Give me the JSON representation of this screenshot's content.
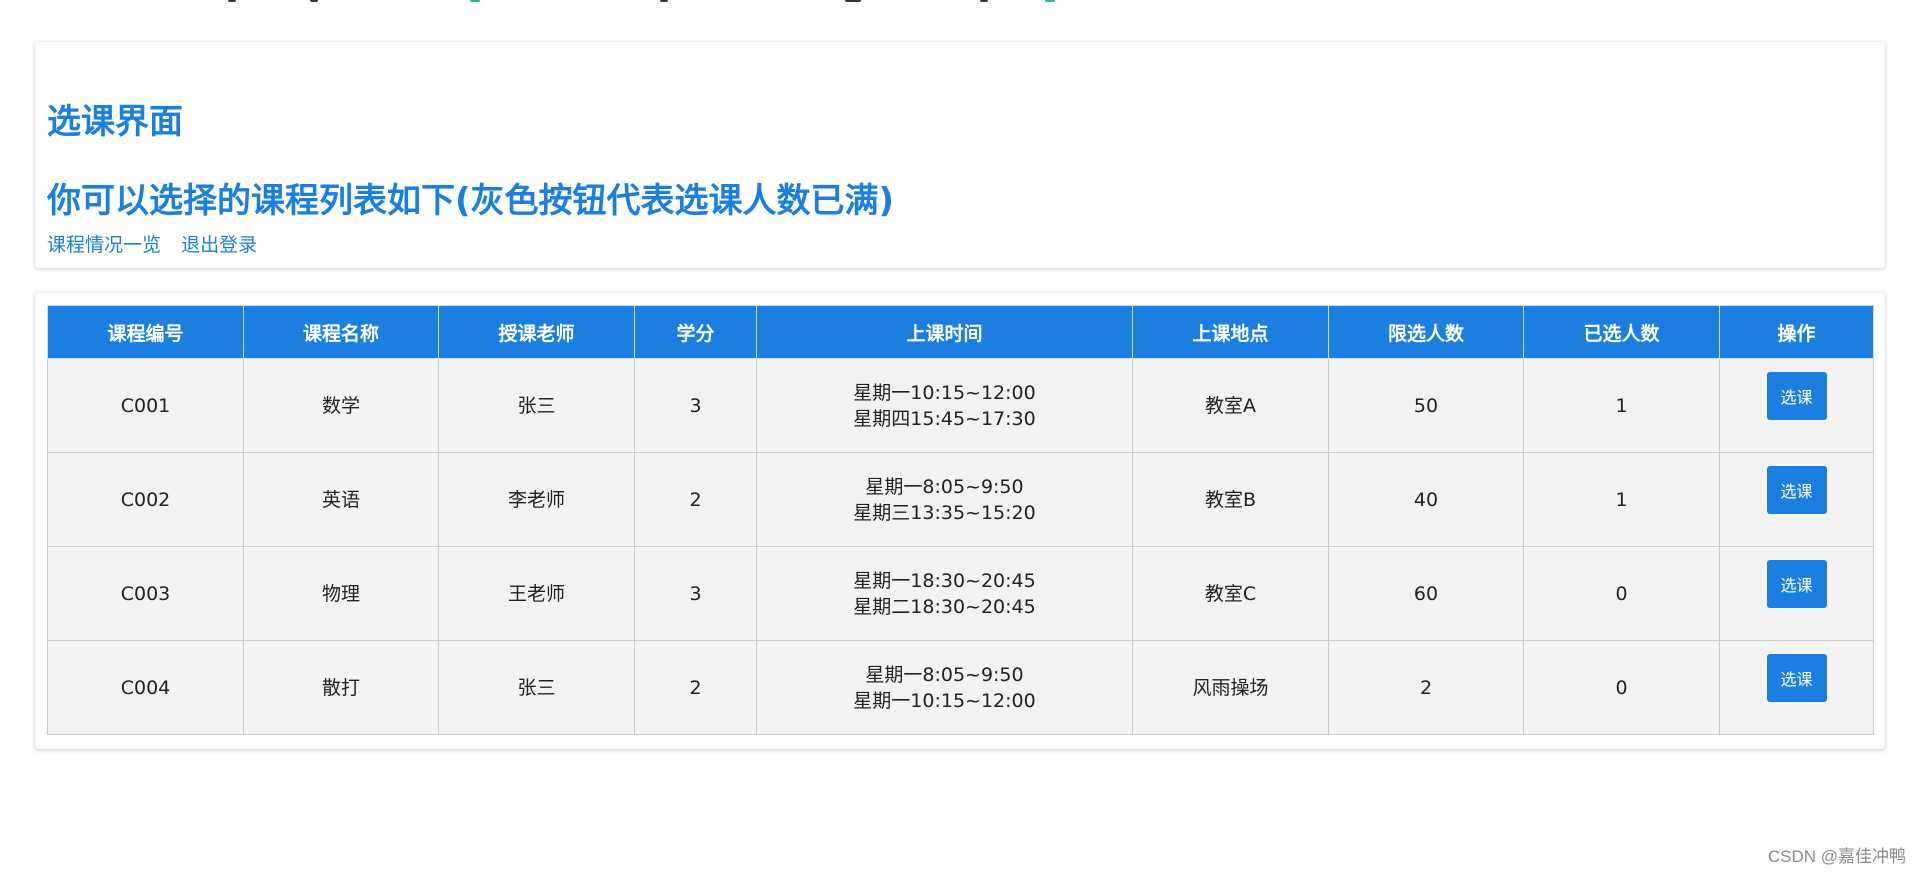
{
  "header": {
    "title": "选课界面",
    "subtitle": "你可以选择的课程列表如下(灰色按钮代表选课人数已满)",
    "links": [
      "课程情况一览",
      "退出登录"
    ]
  },
  "table": {
    "columns": [
      "课程编号",
      "课程名称",
      "授课老师",
      "学分",
      "上课时间",
      "上课地点",
      "限选人数",
      "已选人数",
      "操作"
    ],
    "rows": [
      {
        "id": "C001",
        "name": "数学",
        "teacher": "张三",
        "credit": "3",
        "time": [
          "星期一10:15~12:00",
          "星期四15:45~17:30"
        ],
        "place": "教室A",
        "limit": "50",
        "selected": "1",
        "action": "选课"
      },
      {
        "id": "C002",
        "name": "英语",
        "teacher": "李老师",
        "credit": "2",
        "time": [
          "星期一8:05~9:50",
          "星期三13:35~15:20"
        ],
        "place": "教室B",
        "limit": "40",
        "selected": "1",
        "action": "选课"
      },
      {
        "id": "C003",
        "name": "物理",
        "teacher": "王老师",
        "credit": "3",
        "time": [
          "星期一18:30~20:45",
          "星期二18:30~20:45"
        ],
        "place": "教室C",
        "limit": "60",
        "selected": "0",
        "action": "选课"
      },
      {
        "id": "C004",
        "name": "散打",
        "teacher": "张三",
        "credit": "2",
        "time": [
          "星期一8:05~9:50",
          "星期一10:15~12:00"
        ],
        "place": "风雨操场",
        "limit": "2",
        "selected": "0",
        "action": "选课"
      }
    ]
  },
  "watermark": "CSDN @嘉佳冲鸭",
  "colors": {
    "accent": "#1a7fe0",
    "cell_bg": "#f2f2f2",
    "button_text": "#ffffff"
  }
}
